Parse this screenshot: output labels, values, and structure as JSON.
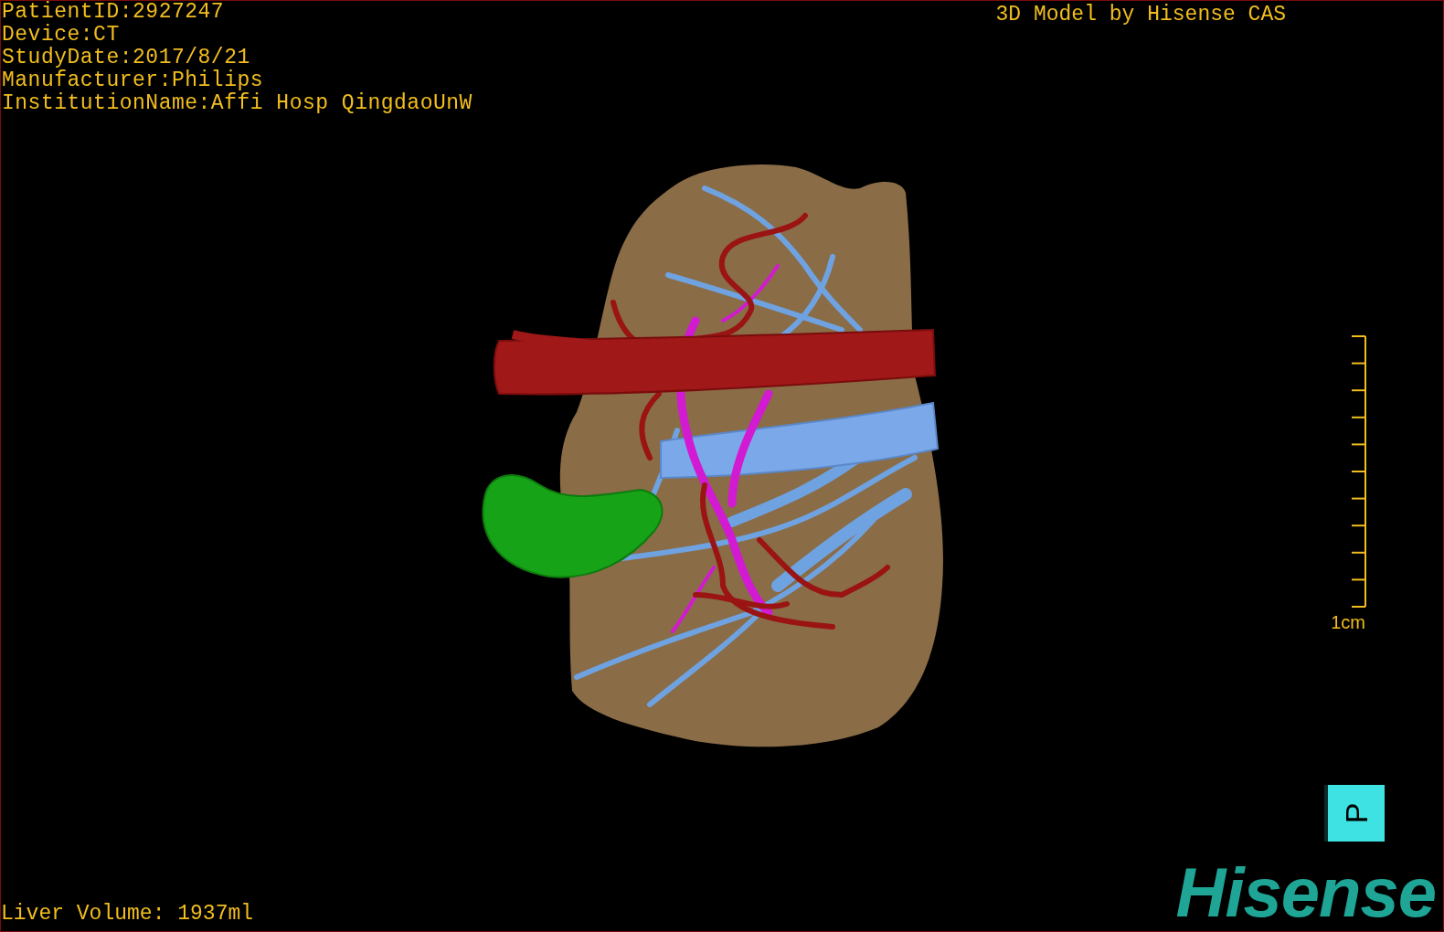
{
  "patient_info": [
    "PatientID:2927247",
    "Device:CT",
    "StudyDate:2017/8/21",
    "Manufacturer:Philips",
    "InstitutionName:Affi Hosp QingdaoUnW"
  ],
  "title": "3D Model by Hisense CAS",
  "scale_bar": {
    "label": "1cm"
  },
  "liver_volume": "Liver Volume: 1937ml",
  "orientation_cube": {
    "label": "P"
  },
  "logo": "Hisense"
}
